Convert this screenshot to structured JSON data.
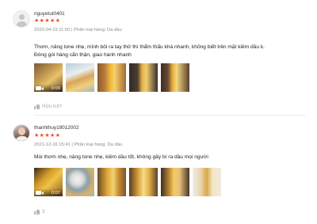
{
  "reviews": [
    {
      "username": "nguyetut0401",
      "stars": "★★★★★",
      "date": "2023-04-19 11:50",
      "separator": "|",
      "variation": "Phân loại hàng: Da dầu",
      "comment_lines": [
        "Thơm, nâng tone nhẹ, mình bôi ra tay thử thì thẩm thấu khá nhanh, không biết trên mặt kiềm dầu k.",
        "Đóng gói hàng cẩn thận, giao hành nhanh"
      ],
      "video_duration": "0:09",
      "helpful_label": "Hữu ích?"
    },
    {
      "username": "thanhthuy18012002",
      "stars": "★★★★★",
      "date": "2021-12-16 15:41",
      "separator": "|",
      "variation": "Phân loại hàng: Da dầu",
      "comment_lines": [
        "Mùi thơm nhẹ, nâng tone nhẹ, kiềm dầu tốt, không gây bí ra dầu mọi người"
      ],
      "video_duration": "0:07",
      "helpful_count": "3"
    }
  ],
  "colors": {
    "stars": "#ee4d2d",
    "meta": "#8a8a8a"
  },
  "icons": [
    "avatar",
    "star-icon",
    "video-camera-icon",
    "thumbs-up-icon"
  ]
}
